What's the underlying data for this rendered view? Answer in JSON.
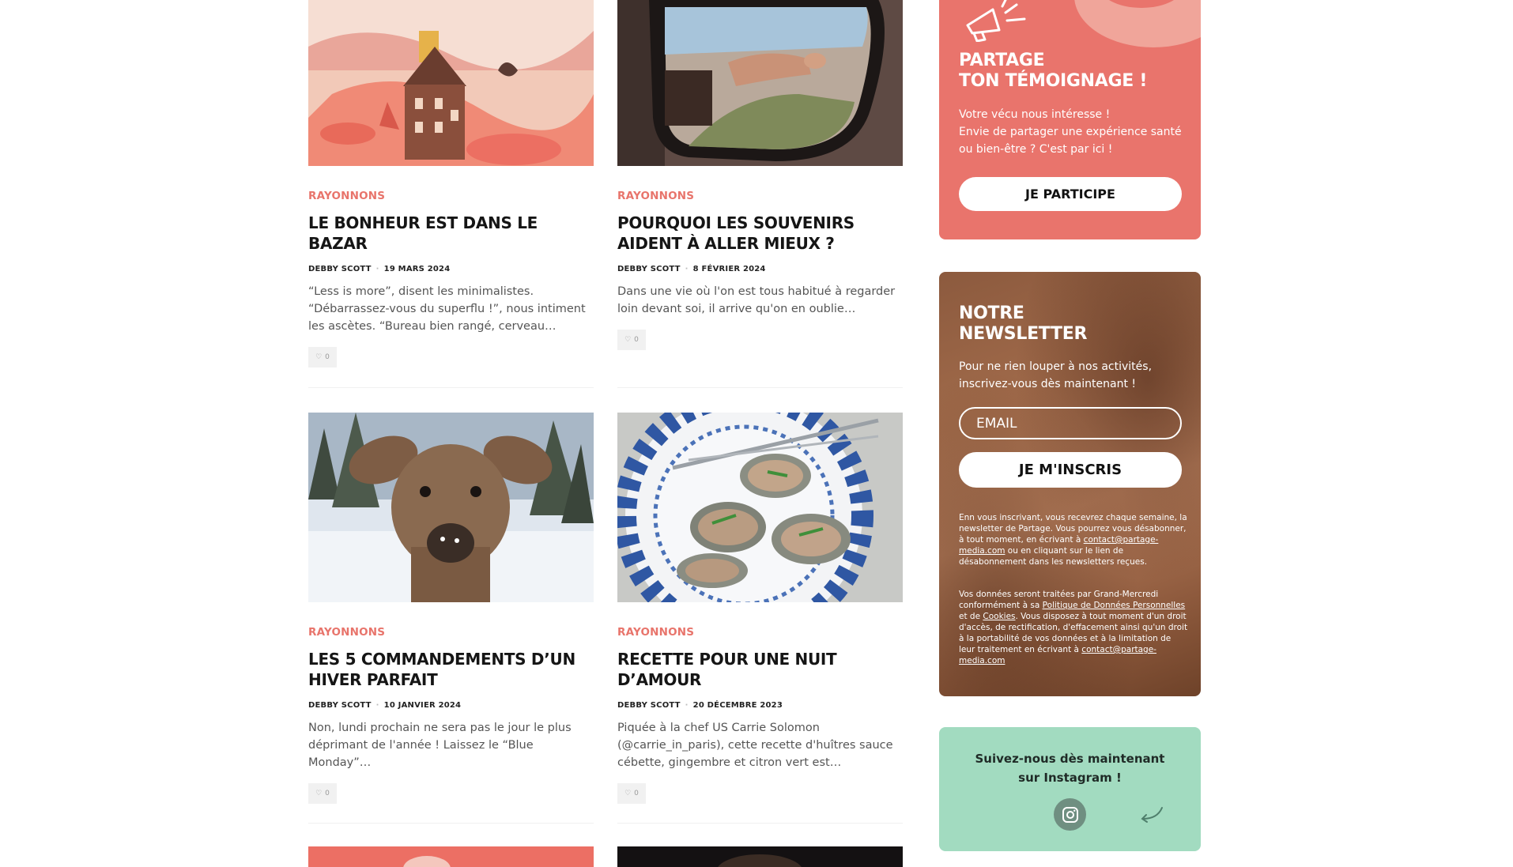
{
  "articles": [
    {
      "category": "RAYONNONS",
      "title": "LE BONHEUR EST DANS LE BAZAR",
      "author": "DEBBY SCOTT",
      "date": "19 MARS 2024",
      "excerpt": "“Less is more”, disent les minimalistes. “Débarrassez-vous du superflu !”, nous intiment les ascètes. “Bureau bien rangé, cerveau…",
      "likes": "0",
      "image_icon": "miniature-house-photo"
    },
    {
      "category": "RAYONNONS",
      "title": "POURQUOI LES SOUVENIRS AIDENT À ALLER MIEUX ?",
      "author": "DEBBY SCOTT",
      "date": "8 FÉVRIER 2024",
      "excerpt": "Dans une vie où l'on est tous habitué à regarder loin devant soi, il arrive qu'on en oublie…",
      "likes": "0",
      "image_icon": "car-mirror-photo"
    },
    {
      "category": "RAYONNONS",
      "title": "LES 5 COMMANDEMENTS D’UN HIVER PARFAIT",
      "author": "DEBBY SCOTT",
      "date": "10 JANVIER 2024",
      "excerpt": "Non, lundi prochain ne sera pas le jour le plus déprimant de l'année ! Laissez le “Blue Monday”…",
      "likes": "0",
      "image_icon": "deer-snow-photo"
    },
    {
      "category": "RAYONNONS",
      "title": "RECETTE POUR UNE NUIT D’AMOUR",
      "author": "DEBBY SCOTT",
      "date": "20 DÉCEMBRE 2023",
      "excerpt": "Piquée à la chef US Carrie Solomon (@carrie_in_paris), cette recette d'huîtres sauce cébette, gingembre et citron vert est…",
      "likes": "0",
      "image_icon": "oysters-plate-photo"
    }
  ],
  "temoignage": {
    "title_line1": "PARTAGE",
    "title_line2": "TON TÉMOIGNAGE !",
    "text_line1": "Votre vécu nous intéresse !",
    "text_line2": "Envie de partager une expérience santé ou bien-être ? C'est par ici !",
    "button": "JE PARTICIPE",
    "icon": "megaphone-icon"
  },
  "newsletter": {
    "title_line1": "NOTRE",
    "title_line2": "NEWSLETTER",
    "text": "Pour ne rien louper à nos activités, inscrivez-vous dès maintenant !",
    "email_placeholder": "EMAIL",
    "button": "JE M'INSCRIS",
    "legal1_pre": "Enn vous inscrivant, vous recevrez chaque semaine, la newsletter de Partage. Vous pourrez vous désabonner, à tout moment, en écrivant à ",
    "legal1_email": "contact@partage-media.com",
    "legal1_post": " ou en cliquant sur le lien de désabonnement dans les newsletters reçues.",
    "legal2_pre": "Vos données seront traitées par Grand-Mercredi conformément à sa ",
    "legal2_link1": "Politique de Données Personnelles",
    "legal2_mid": " et de ",
    "legal2_link2": "Cookies",
    "legal2_post": ". Vous disposez à tout moment d'un droit d'accès, de rectification, d'effacement ainsi qu'un droit à la portabilité de vos données et à la limitation de leur traitement en écrivant à ",
    "legal2_email": "contact@partage-media.com"
  },
  "instagram": {
    "line1": "Suivez-nous dès maintenant",
    "line2": "sur Instagram !",
    "icon": "instagram-icon"
  },
  "colors": {
    "accent": "#e8746b",
    "temoignage_bg": "#e9746c",
    "instagram_bg": "#a2dbc0"
  }
}
